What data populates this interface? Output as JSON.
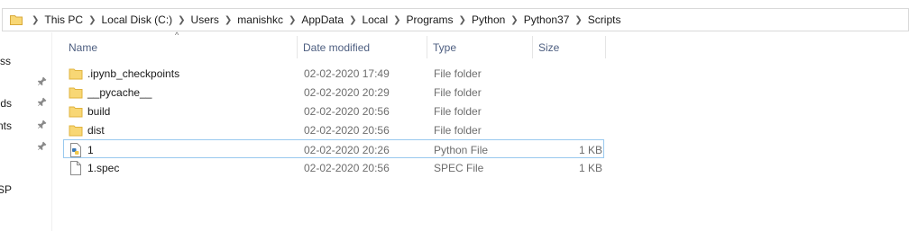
{
  "breadcrumb": [
    {
      "label": "This PC"
    },
    {
      "label": "Local Disk (C:)"
    },
    {
      "label": "Users"
    },
    {
      "label": "manishkc"
    },
    {
      "label": "AppData"
    },
    {
      "label": "Local"
    },
    {
      "label": "Programs"
    },
    {
      "label": "Python"
    },
    {
      "label": "Python37"
    },
    {
      "label": "Scripts"
    }
  ],
  "nav": {
    "items": [
      {
        "label": "ess",
        "pinned": false
      },
      {
        "label": "",
        "pinned": true
      },
      {
        "label": "ds",
        "pinned": true
      },
      {
        "label": "nts",
        "pinned": true
      },
      {
        "label": "",
        "pinned": true
      },
      {
        "label": "OSP",
        "pinned": false
      }
    ]
  },
  "columns": {
    "name": "Name",
    "date": "Date modified",
    "type": "Type",
    "size": "Size",
    "sort_indicator": "^"
  },
  "files": [
    {
      "name": ".ipynb_checkpoints",
      "date": "02-02-2020 17:49",
      "type": "File folder",
      "size": "",
      "icon": "folder-icon"
    },
    {
      "name": "__pycache__",
      "date": "02-02-2020 20:29",
      "type": "File folder",
      "size": "",
      "icon": "folder-icon"
    },
    {
      "name": "build",
      "date": "02-02-2020 20:56",
      "type": "File folder",
      "size": "",
      "icon": "folder-icon"
    },
    {
      "name": "dist",
      "date": "02-02-2020 20:56",
      "type": "File folder",
      "size": "",
      "icon": "folder-icon"
    },
    {
      "name": "1",
      "date": "02-02-2020 20:26",
      "type": "Python File",
      "size": "1 KB",
      "icon": "python-file-icon"
    },
    {
      "name": "1.spec",
      "date": "02-02-2020 20:56",
      "type": "SPEC File",
      "size": "1 KB",
      "icon": "document-icon"
    }
  ],
  "colors": {
    "folder": "#f8d775",
    "folder_dark": "#e0b33d",
    "header_text": "#4d5e80",
    "selection_border": "#99c9ef"
  }
}
